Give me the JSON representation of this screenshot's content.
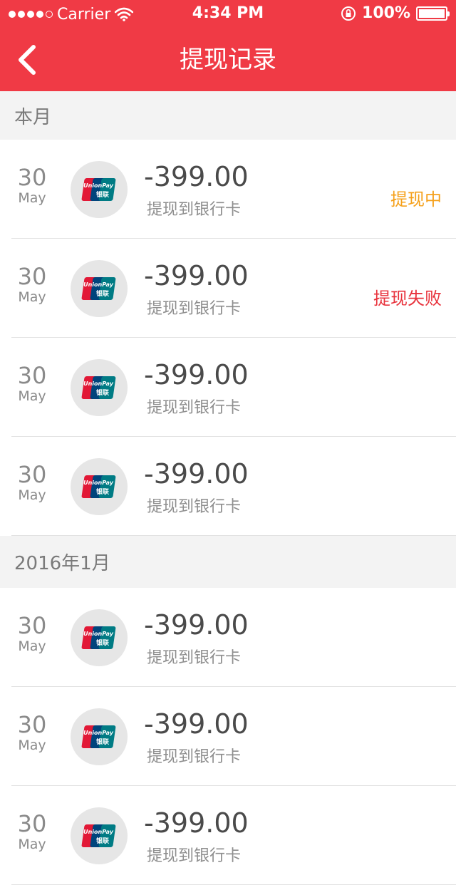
{
  "status_bar": {
    "carrier": "Carrier",
    "time": "4:34 PM",
    "battery": "100%"
  },
  "nav": {
    "title": "提现记录"
  },
  "colors": {
    "brand_red": "#f03a45",
    "status_pending": "#f5a01a",
    "status_failed": "#e8323c"
  },
  "sections": [
    {
      "title": "本月",
      "items": [
        {
          "day": "30",
          "month": "May",
          "amount": "-399.00",
          "desc": "提现到银行卡",
          "status": "提现中",
          "status_type": "pending"
        },
        {
          "day": "30",
          "month": "May",
          "amount": "-399.00",
          "desc": "提现到银行卡",
          "status": "提现失败",
          "status_type": "failed"
        },
        {
          "day": "30",
          "month": "May",
          "amount": "-399.00",
          "desc": "提现到银行卡",
          "status": "",
          "status_type": ""
        },
        {
          "day": "30",
          "month": "May",
          "amount": "-399.00",
          "desc": "提现到银行卡",
          "status": "",
          "status_type": ""
        }
      ]
    },
    {
      "title": "2016年1月",
      "items": [
        {
          "day": "30",
          "month": "May",
          "amount": "-399.00",
          "desc": "提现到银行卡",
          "status": "",
          "status_type": ""
        },
        {
          "day": "30",
          "month": "May",
          "amount": "-399.00",
          "desc": "提现到银行卡",
          "status": "",
          "status_type": ""
        },
        {
          "day": "30",
          "month": "May",
          "amount": "-399.00",
          "desc": "提现到银行卡",
          "status": "",
          "status_type": ""
        }
      ]
    }
  ],
  "icons": {
    "back": "chevron-left-icon",
    "bank_logo": "unionpay-logo-icon"
  },
  "logo_text": {
    "latin": "UnionPay",
    "cn": "银联"
  }
}
